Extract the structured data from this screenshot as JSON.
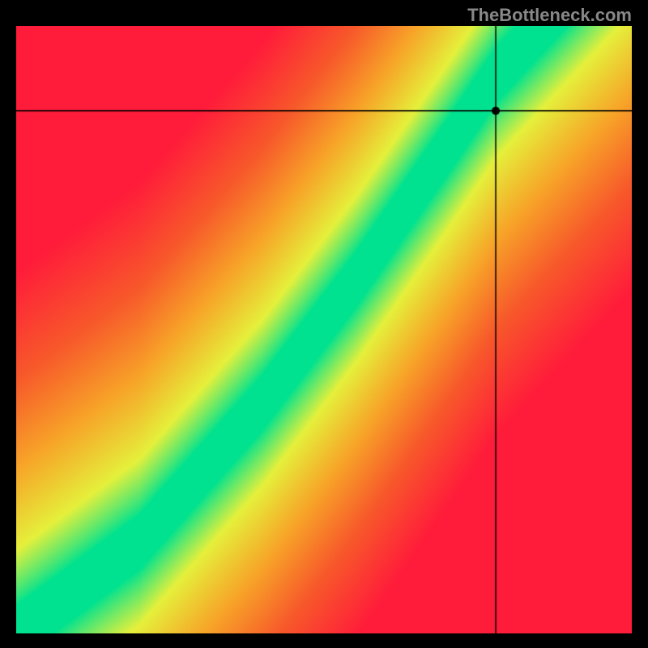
{
  "watermark": "TheBottleneck.com",
  "chart_data": {
    "type": "heatmap",
    "title": "",
    "xlabel": "",
    "ylabel": "",
    "xlim": [
      0,
      100
    ],
    "ylim": [
      0,
      100
    ],
    "crosshair": {
      "x": 78,
      "y": 86
    },
    "marker": {
      "x": 78,
      "y": 86
    },
    "optimal_band": {
      "description": "Green band where ratio is balanced; diverges to red away from it",
      "control_points": [
        {
          "x": 0,
          "y": 0
        },
        {
          "x": 20,
          "y": 15
        },
        {
          "x": 40,
          "y": 38
        },
        {
          "x": 55,
          "y": 58
        },
        {
          "x": 70,
          "y": 80
        },
        {
          "x": 78,
          "y": 92
        },
        {
          "x": 90,
          "y": 105
        }
      ],
      "band_halfwidth_y": 9
    },
    "color_scale": [
      {
        "stop": 0.0,
        "color": "#00e28f"
      },
      {
        "stop": 0.2,
        "color": "#e5f03b"
      },
      {
        "stop": 0.45,
        "color": "#f7a428"
      },
      {
        "stop": 0.7,
        "color": "#f75a2a"
      },
      {
        "stop": 1.0,
        "color": "#ff1c3a"
      }
    ]
  }
}
